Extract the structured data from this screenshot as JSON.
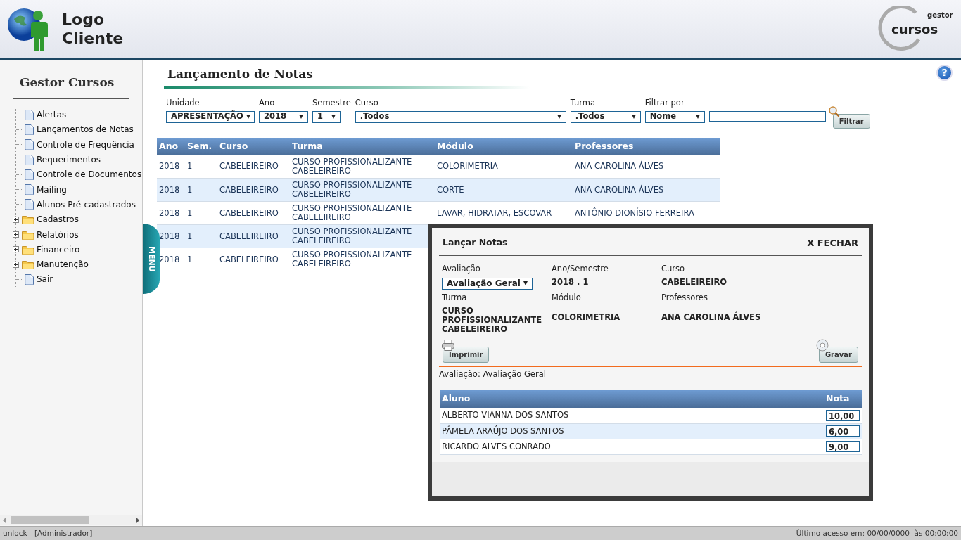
{
  "header": {
    "logo_lines": [
      "Logo",
      "Cliente"
    ],
    "brand_small": "gestor",
    "brand_large": "cursos"
  },
  "sidebar": {
    "title": "Gestor Cursos",
    "items": [
      {
        "label": "Alertas",
        "kind": "page"
      },
      {
        "label": "Lançamentos de Notas",
        "kind": "page"
      },
      {
        "label": "Controle de Frequência",
        "kind": "page"
      },
      {
        "label": "Requerimentos",
        "kind": "page"
      },
      {
        "label": "Controle de Documentos",
        "kind": "page"
      },
      {
        "label": "Mailing",
        "kind": "page"
      },
      {
        "label": "Alunos Pré-cadastrados",
        "kind": "page"
      },
      {
        "label": "Cadastros",
        "kind": "folder",
        "expanded": false
      },
      {
        "label": "Relatórios",
        "kind": "folder",
        "expanded": false
      },
      {
        "label": "Financeiro",
        "kind": "folder",
        "expanded": false
      },
      {
        "label": "Manutenção",
        "kind": "folder",
        "expanded": false
      },
      {
        "label": "Sair",
        "kind": "page"
      }
    ]
  },
  "menu_tab": "MENU",
  "page": {
    "title": "Lançamento de Notas",
    "help": "?"
  },
  "filters": [
    {
      "label": "Unidade",
      "value": "APRESENTAÇÃO"
    },
    {
      "label": "Ano",
      "value": "2018"
    },
    {
      "label": "Semestre",
      "value": "1"
    },
    {
      "label": "Curso",
      "value": ".Todos"
    },
    {
      "label": "Turma",
      "value": ".Todos"
    },
    {
      "label": "Filtrar por",
      "value": "Nome"
    }
  ],
  "filter_button": "Filtrar",
  "table": {
    "columns": [
      "Ano",
      "Sem.",
      "Curso",
      "Turma",
      "Módulo",
      "Professores"
    ],
    "rows": [
      {
        "ano": "2018",
        "sem": "1",
        "curso": "CABELEIREIRO",
        "turma": "CURSO PROFISSIONALIZANTE CABELEIREIRO",
        "modulo": "COLORIMETRIA",
        "professores": "ANA CAROLINA ÁLVES"
      },
      {
        "ano": "2018",
        "sem": "1",
        "curso": "CABELEIREIRO",
        "turma": "CURSO PROFISSIONALIZANTE CABELEIREIRO",
        "modulo": "CORTE",
        "professores": "ANA CAROLINA ÁLVES"
      },
      {
        "ano": "2018",
        "sem": "1",
        "curso": "CABELEIREIRO",
        "turma": "CURSO PROFISSIONALIZANTE CABELEIREIRO",
        "modulo": "LAVAR, HIDRATAR, ESCOVAR",
        "professores": "ANTÔNIO DIONÍSIO FERREIRA"
      },
      {
        "ano": "2018",
        "sem": "1",
        "curso": "CABELEIREIRO",
        "turma": "CURSO PROFISSIONALIZANTE CABELEIREIRO"
      },
      {
        "ano": "2018",
        "sem": "1",
        "curso": "CABELEIREIRO",
        "turma": "CURSO PROFISSIONALIZANTE CABELEIREIRO"
      }
    ]
  },
  "modal": {
    "title": "Lançar Notas",
    "close": "X FECHAR",
    "fields": [
      {
        "label": "Avaliação",
        "kind": "select",
        "value": "Avaliação Geral"
      },
      {
        "label": "Ano/Semestre",
        "kind": "text",
        "value": "2018 . 1"
      },
      {
        "label": "Curso",
        "kind": "text",
        "value": "CABELEIREIRO"
      },
      {
        "label": "Turma",
        "kind": "text",
        "value": "CURSO PROFISSIONALIZANTE CABELEIREIRO"
      },
      {
        "label": "Módulo",
        "kind": "text",
        "value": "COLORIMETRIA"
      },
      {
        "label": "Professores",
        "kind": "text",
        "value": "ANA CAROLINA ÁLVES"
      }
    ],
    "print_button": "Imprimir",
    "save_button": "Gravar",
    "summary": "Avaliação: Avaliação Geral",
    "grades": {
      "columns": [
        "Aluno",
        "Nota"
      ],
      "rows": [
        {
          "aluno": "ALBERTO VIANNA DOS SANTOS",
          "nota": "10,00"
        },
        {
          "aluno": "PÂMELA ARAÚJO DOS SANTOS",
          "nota": "6,00"
        },
        {
          "aluno": "RICARDO ALVES CONRADO",
          "nota": "9,00"
        }
      ]
    }
  },
  "status_bar": {
    "left": "unlock - [Administrador]",
    "right": "Último acesso em: 00/00/0000  às 00:00:00"
  }
}
